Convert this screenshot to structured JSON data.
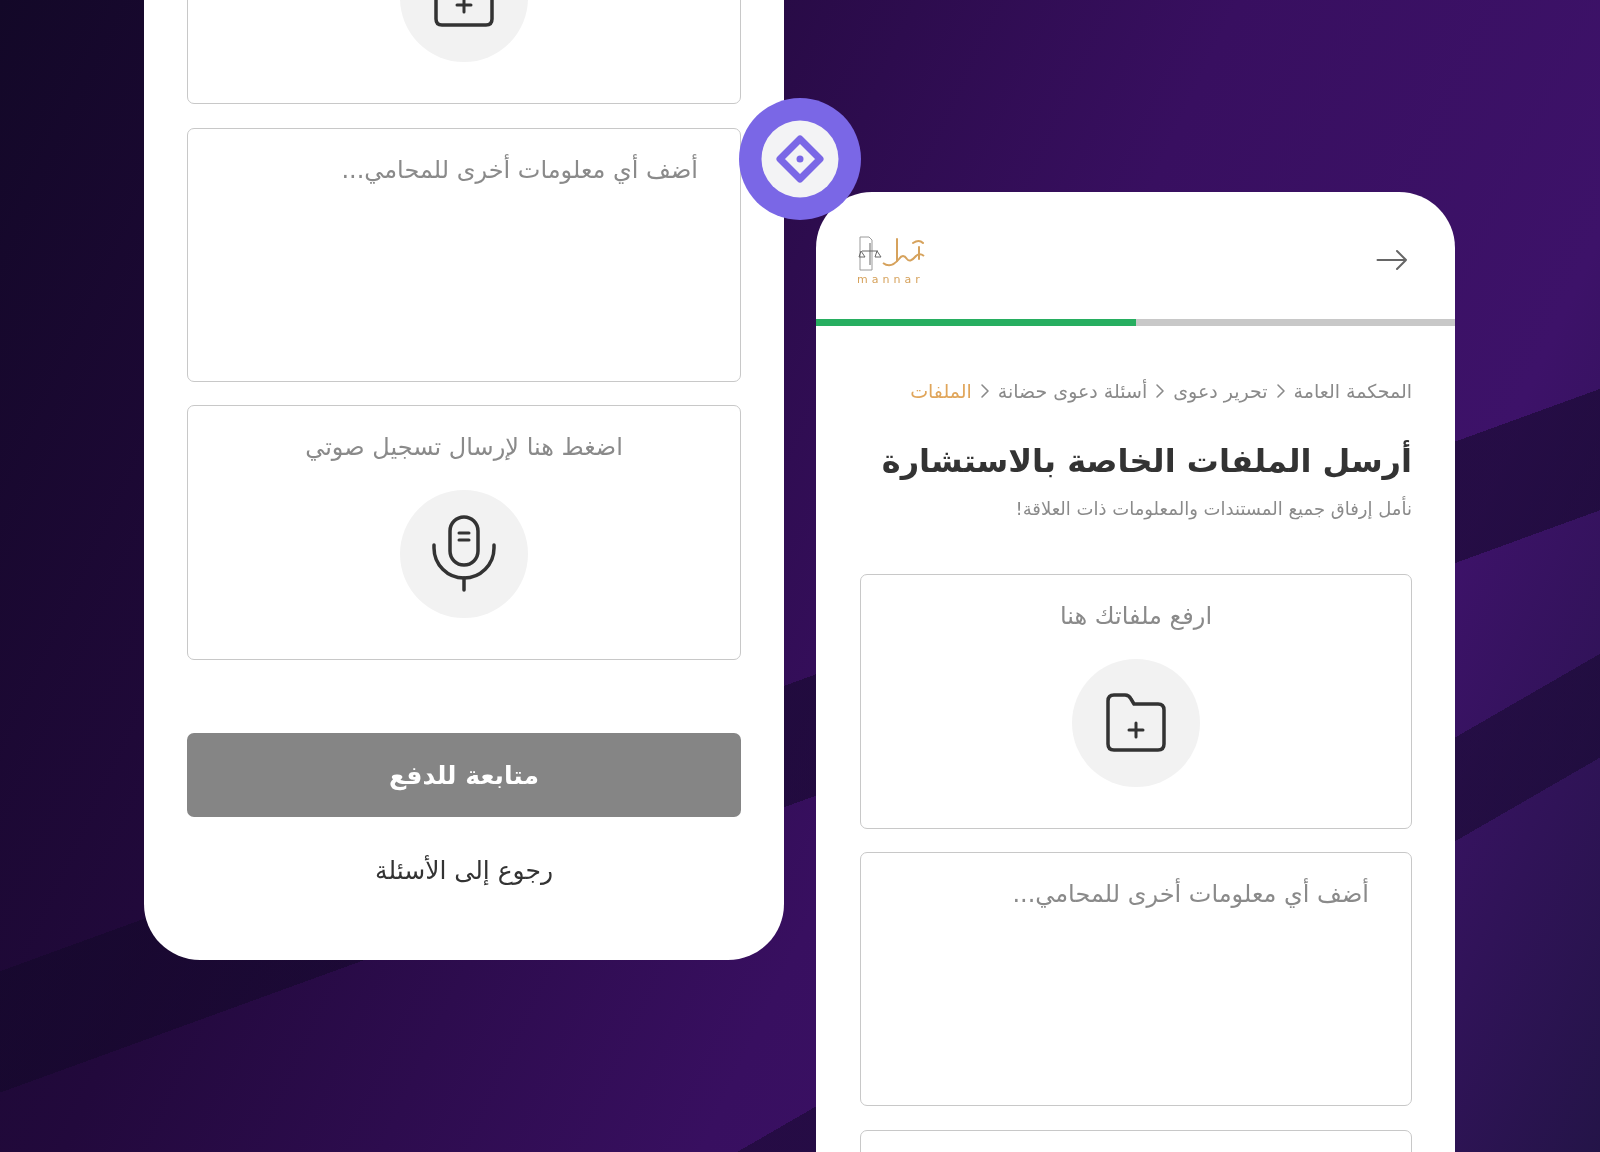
{
  "left_screen": {
    "notes_field": {
      "placeholder": "أضف أي معلومات أخرى للمحامي..."
    },
    "voice_note": {
      "label": "اضغط هنا لإرسال تسجيل صوتي"
    },
    "continue_button": {
      "label": "متابعة للدفع",
      "disabled": true
    },
    "back_link": {
      "label": "رجوع إلى الأسئلة"
    }
  },
  "right_screen": {
    "logo": {
      "text": "mannar"
    },
    "progress": {
      "level": 0.5
    },
    "breadcrumb": [
      {
        "label": "المحكمة العامة",
        "selected": false
      },
      {
        "label": "تحرير دعوى",
        "selected": false
      },
      {
        "label": "أسئلة دعوى حضانة",
        "selected": false
      },
      {
        "label": "الملفات",
        "selected": true
      }
    ],
    "title": "أرسل الملفات الخاصة بالاستشارة",
    "subtitle": "نأمل إرفاق جميع المستندات والمعلومات ذات العلاقة!",
    "upload_box": {
      "label": "ارفع ملفاتك هنا"
    },
    "notes_field": {
      "placeholder": "أضف أي معلومات أخرى للمحامي..."
    }
  }
}
